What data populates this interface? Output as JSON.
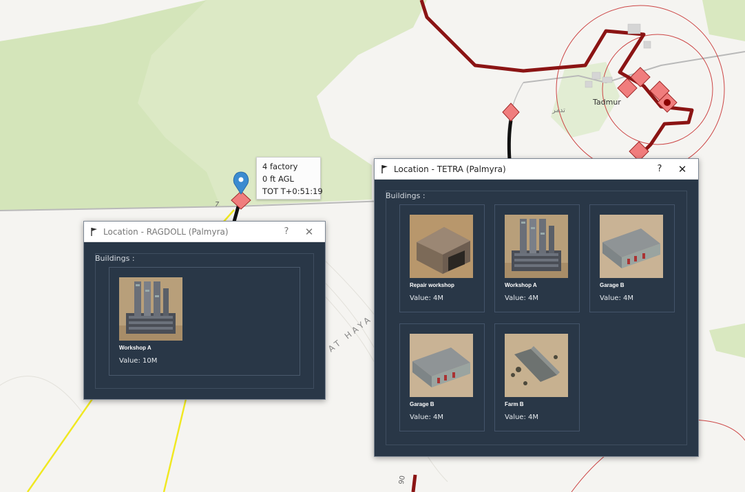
{
  "map": {
    "city_label": "Tadmur",
    "city_label_ar": "تدمر",
    "road_number_left": "7",
    "road_number_bottom": "90",
    "terrain_label": "AT HAYA"
  },
  "tooltip": {
    "line1": "4 factory",
    "line2": "0 ft AGL",
    "line3": "TOT T+0:51:19"
  },
  "ragdoll": {
    "title": "Location - RAGDOLL (Palmyra)",
    "help": "?",
    "close": "✕",
    "group_title": "Buildings :",
    "buildings": [
      {
        "name": "Workshop A",
        "value": "Value: 10M",
        "type": "tower"
      }
    ]
  },
  "tetra": {
    "title": "Location - TETRA (Palmyra)",
    "help": "?",
    "close": "✕",
    "group_title": "Buildings :",
    "buildings": [
      {
        "name": "Repair workshop",
        "value": "Value: 4M",
        "type": "hangar"
      },
      {
        "name": "Workshop A",
        "value": "Value: 4M",
        "type": "tower"
      },
      {
        "name": "Garage B",
        "value": "Value: 4M",
        "type": "garage"
      },
      {
        "name": "Garage B",
        "value": "Value: 4M",
        "type": "garage"
      },
      {
        "name": "Farm B",
        "value": "Value: 4M",
        "type": "farm"
      }
    ]
  },
  "colors": {
    "window_bg": "#293747",
    "route": "#8b1414",
    "target_marker": "#f07d7d",
    "road_yellow": "#f0e821",
    "waypoint_pin": "#3b8bd0"
  }
}
